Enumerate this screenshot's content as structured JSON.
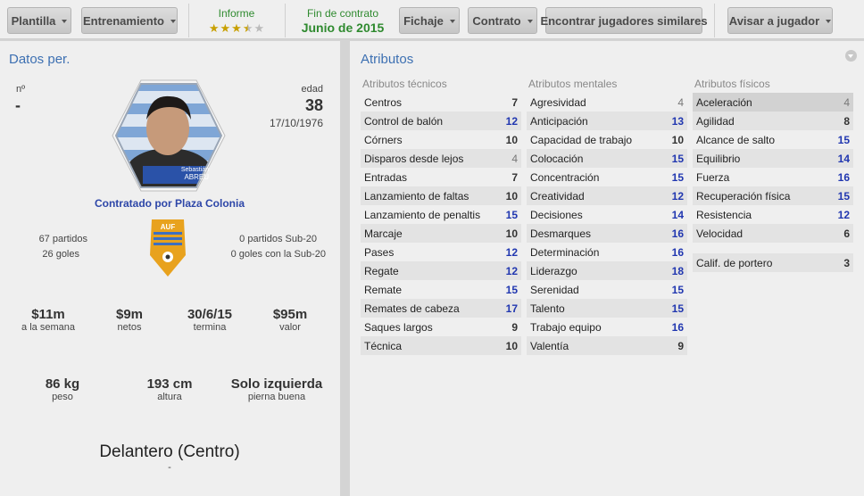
{
  "toolbar": {
    "plantilla": "Plantilla",
    "entrenamiento": "Entrenamiento",
    "informe_label": "Informe",
    "informe_rating": 3.5,
    "fin_label": "Fin de contrato",
    "fin_value": "Junio de 2015",
    "fichaje": "Fichaje",
    "contrato": "Contrato",
    "similares": "Encontrar jugadores similares",
    "avisar": "Avisar a jugador"
  },
  "player": {
    "section_title": "Datos per.",
    "number_label": "nº",
    "number_value": "-",
    "age_label": "edad",
    "age_value": "38",
    "birthdate": "17/10/1976",
    "card_first": "Sebastián",
    "card_last": "ABREU",
    "contracted_by": "Contratado por Plaza Colonia",
    "matches": "67 partidos",
    "goals": "26 goles",
    "u20_matches": "0 partidos Sub-20",
    "u20_goals": "0 goles con la Sub-20",
    "federation": "AUF",
    "wage": "$11m",
    "wage_label": "a la semana",
    "net": "$9m",
    "net_label": "netos",
    "expires": "30/6/15",
    "expires_label": "termina",
    "value": "$95m",
    "value_label": "valor",
    "weight": "86 kg",
    "weight_label": "peso",
    "height": "193 cm",
    "height_label": "altura",
    "foot": "Solo izquierda",
    "foot_label": "pierna buena",
    "position": "Delantero (Centro)",
    "position_sub": "-"
  },
  "attributes": {
    "title": "Atributos",
    "technical": {
      "header": "Atributos técnicos",
      "items": [
        {
          "name": "Centros",
          "value": "7"
        },
        {
          "name": "Control de balón",
          "value": "12"
        },
        {
          "name": "Córners",
          "value": "10"
        },
        {
          "name": "Disparos desde lejos",
          "value": "4"
        },
        {
          "name": "Entradas",
          "value": "7"
        },
        {
          "name": "Lanzamiento de faltas",
          "value": "10"
        },
        {
          "name": "Lanzamiento de penaltis",
          "value": "15"
        },
        {
          "name": "Marcaje",
          "value": "10"
        },
        {
          "name": "Pases",
          "value": "12"
        },
        {
          "name": "Regate",
          "value": "12"
        },
        {
          "name": "Remate",
          "value": "15"
        },
        {
          "name": "Remates de cabeza",
          "value": "17"
        },
        {
          "name": "Saques largos",
          "value": "9"
        },
        {
          "name": "Técnica",
          "value": "10"
        }
      ]
    },
    "mental": {
      "header": "Atributos mentales",
      "items": [
        {
          "name": "Agresividad",
          "value": "4"
        },
        {
          "name": "Anticipación",
          "value": "13"
        },
        {
          "name": "Capacidad de trabajo",
          "value": "10"
        },
        {
          "name": "Colocación",
          "value": "15"
        },
        {
          "name": "Concentración",
          "value": "15"
        },
        {
          "name": "Creatividad",
          "value": "12"
        },
        {
          "name": "Decisiones",
          "value": "14"
        },
        {
          "name": "Desmarques",
          "value": "16"
        },
        {
          "name": "Determinación",
          "value": "16"
        },
        {
          "name": "Liderazgo",
          "value": "18"
        },
        {
          "name": "Serenidad",
          "value": "15"
        },
        {
          "name": "Talento",
          "value": "15"
        },
        {
          "name": "Trabajo equipo",
          "value": "16"
        },
        {
          "name": "Valentía",
          "value": "9"
        }
      ]
    },
    "physical": {
      "header": "Atributos físicos",
      "items": [
        {
          "name": "Aceleración",
          "value": "4"
        },
        {
          "name": "Agilidad",
          "value": "8"
        },
        {
          "name": "Alcance de salto",
          "value": "15"
        },
        {
          "name": "Equilibrio",
          "value": "14"
        },
        {
          "name": "Fuerza",
          "value": "16"
        },
        {
          "name": "Recuperación física",
          "value": "15"
        },
        {
          "name": "Resistencia",
          "value": "12"
        },
        {
          "name": "Velocidad",
          "value": "6"
        }
      ],
      "goalkeeper": {
        "name": "Calif. de portero",
        "value": "3"
      }
    }
  },
  "colors": {
    "accent": "#3d70b2",
    "high_value": "#2137b0",
    "green": "#2f8a2f",
    "uruguay_blue": "#7fa6d6",
    "auf_gold": "#e8a21e"
  }
}
